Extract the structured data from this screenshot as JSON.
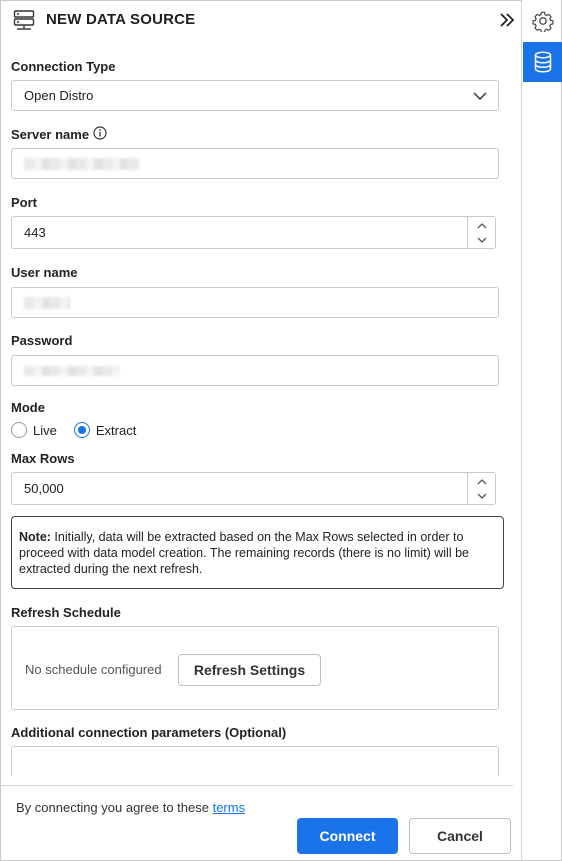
{
  "header": {
    "title": "NEW DATA SOURCE",
    "icon": "server-icon",
    "collapse_icon": "double-chevron-right-icon"
  },
  "rail": {
    "items": [
      {
        "icon": "gear-icon",
        "active": false
      },
      {
        "icon": "database-icon",
        "active": true
      }
    ]
  },
  "form": {
    "connection_type": {
      "label": "Connection Type",
      "value": "Open Distro"
    },
    "server_name": {
      "label": "Server name",
      "value": ""
    },
    "port": {
      "label": "Port",
      "value": "443"
    },
    "user_name": {
      "label": "User name",
      "value": ""
    },
    "password": {
      "label": "Password",
      "value": ""
    },
    "mode": {
      "label": "Mode",
      "options": [
        "Live",
        "Extract"
      ],
      "selected": "Extract"
    },
    "max_rows": {
      "label": "Max Rows",
      "value": "50,000"
    }
  },
  "note": {
    "prefix": "Note:",
    "text": " Initially, data will be extracted based on the Max Rows selected in order to proceed with data model creation. The remaining records (there is no limit) will be extracted during the next refresh."
  },
  "refresh": {
    "label": "Refresh Schedule",
    "status": "No schedule configured",
    "button": "Refresh Settings"
  },
  "additional": {
    "label": "Additional connection parameters (Optional)",
    "value": ""
  },
  "footer": {
    "terms_text": "By connecting you agree to these ",
    "terms_link": "terms",
    "connect": "Connect",
    "cancel": "Cancel"
  },
  "colors": {
    "accent": "#1a73e8"
  }
}
